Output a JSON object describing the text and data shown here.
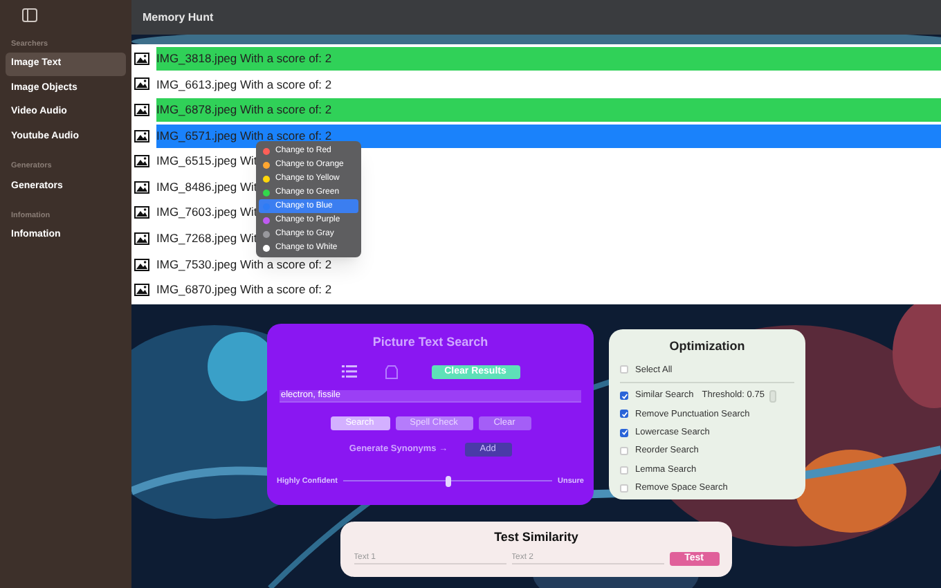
{
  "window": {
    "title": "Memory Hunt"
  },
  "sidebar": {
    "sections": [
      {
        "heading": "Searchers",
        "items": [
          {
            "label": "Image Text",
            "selected": true
          },
          {
            "label": "Image Objects",
            "selected": false
          },
          {
            "label": "Video Audio",
            "selected": false
          },
          {
            "label": "Youtube Audio",
            "selected": false
          }
        ]
      },
      {
        "heading": "Generators",
        "items": [
          {
            "label": "Generators",
            "selected": false
          }
        ]
      },
      {
        "heading": "Infomation",
        "items": [
          {
            "label": "Infomation",
            "selected": false
          }
        ]
      }
    ]
  },
  "results": [
    {
      "text": "IMG_3818.jpeg With a score of: 2",
      "color": "#30d158"
    },
    {
      "text": "IMG_6613.jpeg With a score of: 2",
      "color": "#ffffff"
    },
    {
      "text": "IMG_6878.jpeg With a score of: 2",
      "color": "#30d158"
    },
    {
      "text": "IMG_6571.jpeg With a score of: 2",
      "color": "#1a82fb"
    },
    {
      "text": "IMG_6515.jpeg Wit",
      "color": "#ffffff"
    },
    {
      "text": "IMG_8486.jpeg Wit",
      "color": "#ffffff"
    },
    {
      "text": "IMG_7603.jpeg Wit",
      "color": "#ffffff"
    },
    {
      "text": "IMG_7268.jpeg Wit",
      "color": "#ffffff"
    },
    {
      "text": "IMG_7530.jpeg With a score of: 2",
      "color": "#ffffff"
    },
    {
      "text": "IMG_6870.jpeg With a score of: 2",
      "color": "#ffffff"
    }
  ],
  "context_menu": [
    {
      "label": "Change to Red",
      "color": "#ff5f57",
      "selected": false
    },
    {
      "label": "Change to Orange",
      "color": "#ffa630",
      "selected": false
    },
    {
      "label": "Change to Yellow",
      "color": "#ffd60a",
      "selected": false
    },
    {
      "label": "Change to Green",
      "color": "#32d74b",
      "selected": false
    },
    {
      "label": "Change to Blue",
      "color": "#2e7cf6",
      "selected": true
    },
    {
      "label": "Change to Purple",
      "color": "#bf5af2",
      "selected": false
    },
    {
      "label": "Change to Gray",
      "color": "#98989d",
      "selected": false
    },
    {
      "label": "Change to White",
      "color": "#ffffff",
      "selected": false
    }
  ],
  "search_panel": {
    "title": "Picture Text Search",
    "clear_results": "Clear Results",
    "query": "electron, fissile",
    "buttons": [
      "Search",
      "Spell Check",
      "Clear"
    ],
    "synonyms": "Generate Synonyms →",
    "add": "Add",
    "slider": {
      "left": "Highly Confident",
      "right": "Unsure",
      "level": 0.5
    }
  },
  "optimization": {
    "title": "Optimization",
    "select_all": {
      "label": "Select All",
      "checked": false
    },
    "options": [
      {
        "label": "Similar Search",
        "checked": true,
        "threshold": "Threshold: 0.75"
      },
      {
        "label": "Remove Punctuation Search",
        "checked": true
      },
      {
        "label": "Lowercase Search",
        "checked": true
      },
      {
        "label": "Reorder Search",
        "checked": false
      },
      {
        "label": "Lemma Search",
        "checked": false
      },
      {
        "label": "Remove Space Search",
        "checked": false
      }
    ]
  },
  "similarity": {
    "title": "Test Similarity",
    "placeholder_1": "Text 1",
    "placeholder_2": "Text 2",
    "button": "Test"
  }
}
